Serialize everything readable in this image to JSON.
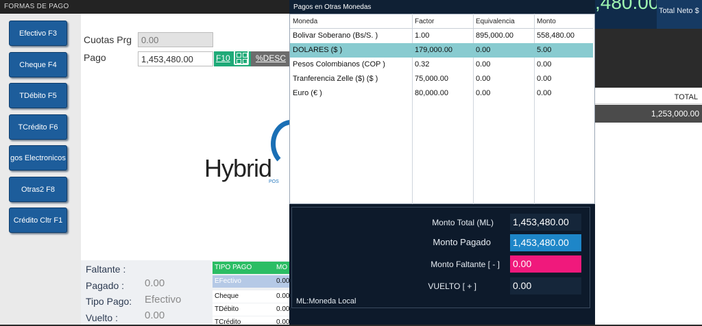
{
  "background": {
    "total_big": ",480.00",
    "total_neto_label": "Total Neto $",
    "total_header": "TOTAL",
    "total_value": "1,253,000.00"
  },
  "formas_pago": {
    "title": "FORMAS DE PAGO",
    "buttons": [
      {
        "label": "Efectivo F3"
      },
      {
        "label": "Cheque F4"
      },
      {
        "label": "TDébito F5"
      },
      {
        "label": "TCrédito F6"
      },
      {
        "label": "gos Electronicos"
      },
      {
        "label": "Otras2 F8"
      },
      {
        "label": "Crédito Cltr F1"
      }
    ],
    "cuotas_label": "Cuotas Prg",
    "cuotas_value": "0.00",
    "pago_label": "Pago",
    "pago_value": "1,453,480.00",
    "f10_label": "F10",
    "desc_label": "%DESC",
    "logo_text": "Hybrid",
    "logo_sub": "POS",
    "faltante_label": "Faltante   :",
    "pagado_label": "Pagado    :",
    "pagado_value": "0.00",
    "tipo_pago_label": "Tipo Pago:",
    "tipo_pago_value": "Efectivo",
    "vuelto_label": "Vuelto     :",
    "vuelto_value": "0.00",
    "tipo_pago_table": {
      "header_tipo": "TIPO PAGO",
      "header_monto": "MO",
      "rows": [
        {
          "tipo": "EFectivo",
          "monto": "0.00"
        },
        {
          "tipo": "Cheque",
          "monto": "0.00"
        },
        {
          "tipo": "TDébito",
          "monto": "0.00"
        },
        {
          "tipo": "TCrédito",
          "monto": "0.00"
        }
      ]
    }
  },
  "otras_monedas": {
    "title": "Pagos en Otras Monedas",
    "columns": [
      "Moneda",
      "Factor",
      "Equivalencia",
      "Monto"
    ],
    "rows": [
      {
        "moneda": "Bolivar Soberano (Bs/S. )",
        "factor": "1.00",
        "equivalencia": "895,000.00",
        "monto": "558,480.00"
      },
      {
        "moneda": "DOLARES ($ )",
        "factor": "179,000.00",
        "equivalencia": "0.00",
        "monto": "5.00"
      },
      {
        "moneda": "Pesos Colombianos (COP )",
        "factor": "0.32",
        "equivalencia": "0.00",
        "monto": "0.00"
      },
      {
        "moneda": "Tranferencia Zelle  ($) ($ )",
        "factor": "75,000.00",
        "equivalencia": "0.00",
        "monto": "0.00"
      },
      {
        "moneda": "Euro (€ )",
        "factor": "80,000.00",
        "equivalencia": "0.00",
        "monto": "0.00"
      }
    ],
    "selected_row": 1,
    "summary": {
      "monto_total_label": "Monto Total (ML)",
      "monto_total_value": "1,453,480.00",
      "monto_pagado_label": "Monto Pagado",
      "monto_pagado_value": "1,453,480.00",
      "monto_faltante_label": "Monto Faltante [ - ]",
      "monto_faltante_value": "0.00",
      "vuelto_label": "VUELTO [ + ]",
      "vuelto_value": "0.00",
      "ml_note": "ML:Moneda  Local"
    }
  },
  "colors": {
    "button_blue": "#1d5d9b",
    "f10_green": "#1faa78",
    "selected_row": "#88cbd0",
    "pagado_blue": "#1e86c8",
    "faltante_pink": "#f0197c",
    "header_green": "#2bbd64"
  }
}
